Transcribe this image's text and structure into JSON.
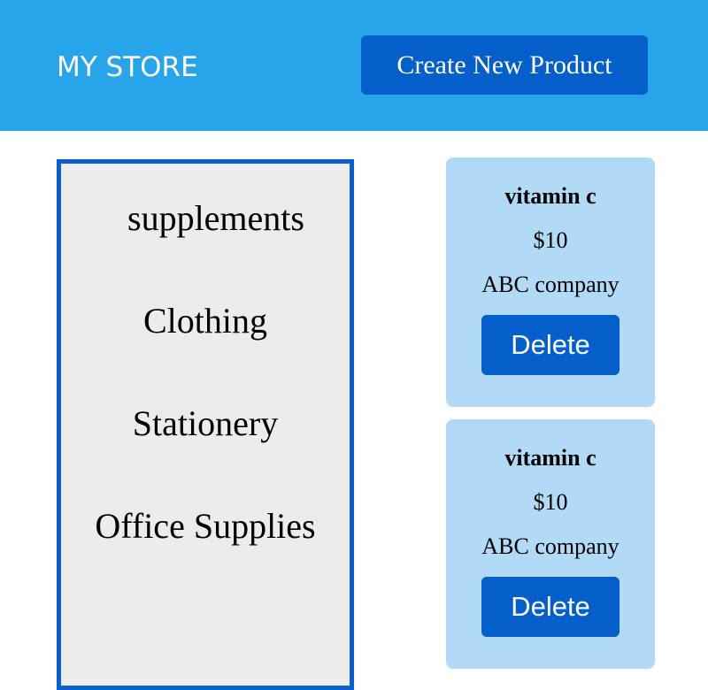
{
  "header": {
    "logo": "MY STORE",
    "create_button_label": "Create New Product"
  },
  "sidebar": {
    "categories": [
      "supplements",
      "Clothing",
      "Stationery",
      "Office Supplies"
    ]
  },
  "products": [
    {
      "name": "vitamin c",
      "price": "$10",
      "company": "ABC company",
      "delete_label": "Delete"
    },
    {
      "name": "vitamin c",
      "price": "$10",
      "company": "ABC company",
      "delete_label": "Delete"
    }
  ],
  "colors": {
    "header_bg": "#27a4ea",
    "button_bg": "#045fcb",
    "card_bg": "#b1daf7",
    "sidebar_border": "#0a5fcc",
    "sidebar_bg": "#ececec"
  }
}
